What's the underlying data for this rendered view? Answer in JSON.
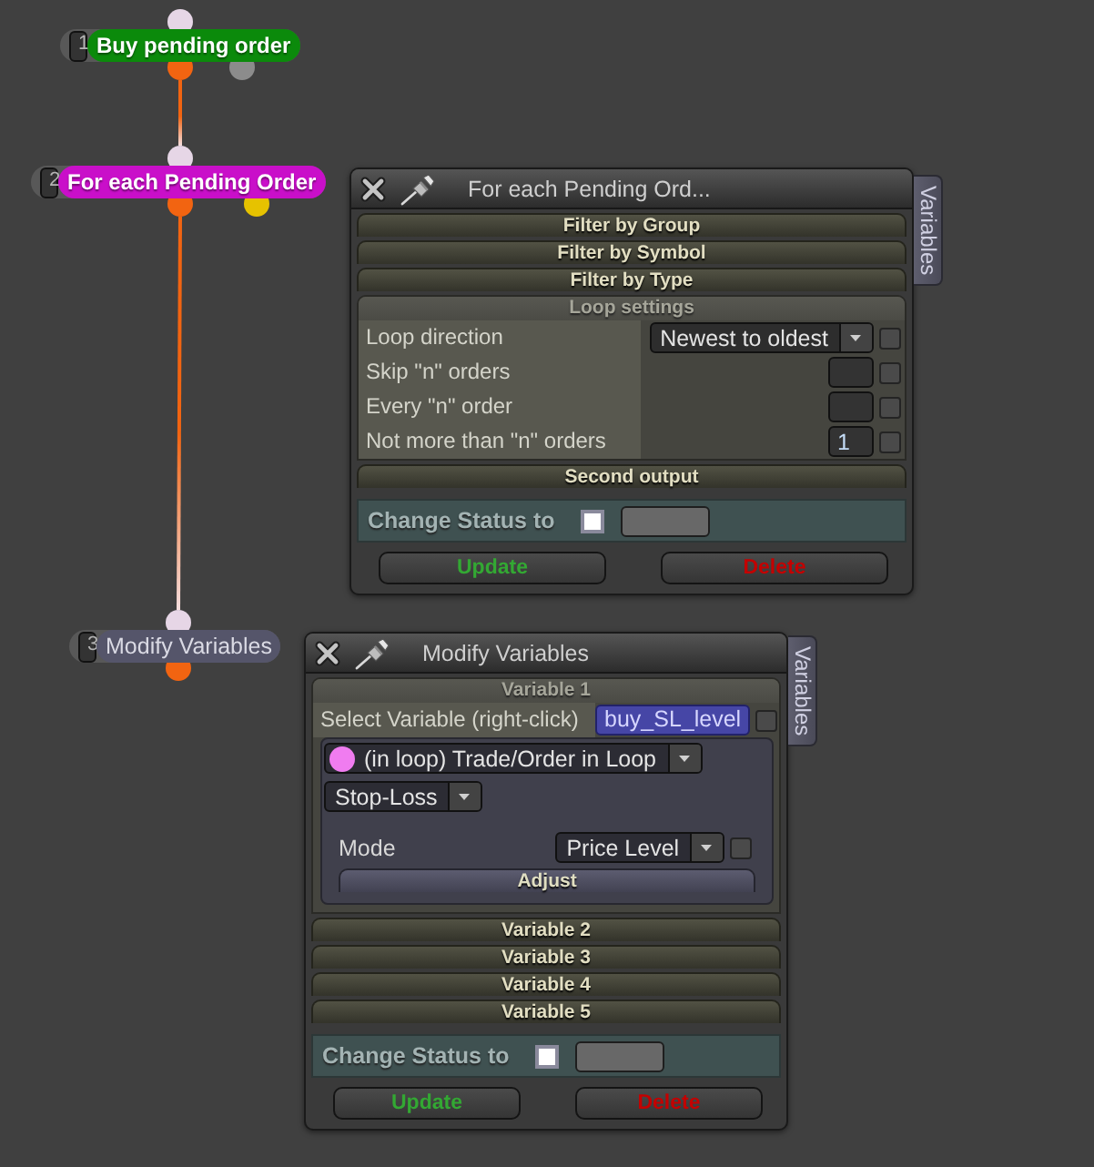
{
  "nodes": [
    {
      "number": "1",
      "label": "Buy pending order",
      "kind": "accent",
      "color": "#0b8a0b",
      "outputs": [
        {
          "color": "#f26411",
          "connected": true
        },
        {
          "color": "#8c8c8c",
          "connected": false
        }
      ]
    },
    {
      "number": "2",
      "label": "For each Pending Order",
      "kind": "accent",
      "color": "#c90fc9",
      "outputs": [
        {
          "color": "#f26411",
          "connected": true
        },
        {
          "color": "#e6c200",
          "connected": false
        }
      ]
    },
    {
      "number": "3",
      "label": "Modify Variables",
      "kind": "plain",
      "color": "#55556a",
      "outputs": [
        {
          "color": "#f26411",
          "connected": false
        }
      ]
    }
  ],
  "panels": [
    {
      "title": "For each Pending Ord...",
      "side_tab": "Variables",
      "sections": [
        {
          "label": "Filter by Group",
          "expanded": false
        },
        {
          "label": "Filter by Symbol",
          "expanded": false
        },
        {
          "label": "Filter by Type",
          "expanded": false
        },
        {
          "label": "Loop settings",
          "expanded": true,
          "rows": [
            {
              "kind": "dropdown",
              "label": "Loop direction",
              "value": "Newest to oldest",
              "checked": false
            },
            {
              "kind": "number",
              "label": "Skip \"n\" orders",
              "checked": false
            },
            {
              "kind": "number",
              "label": "Every \"n\" order",
              "checked": false
            },
            {
              "kind": "number",
              "label": "Not more than \"n\" orders",
              "value": "1",
              "checked": false
            }
          ]
        },
        {
          "label": "Second output",
          "expanded": false
        }
      ],
      "status": {
        "label": "Change Status to",
        "checked": false
      },
      "buttons": [
        {
          "label": "Update",
          "kind": "update"
        },
        {
          "label": "Delete",
          "kind": "delete"
        }
      ]
    },
    {
      "title": "Modify Variables",
      "side_tab": "Variables",
      "sections": [
        {
          "label": "Variable 1",
          "expanded": true,
          "rows": [
            {
              "kind": "variable",
              "label": "Select Variable (right-click)",
              "value": "buy_SL_level",
              "checked": false
            },
            {
              "kind": "group",
              "rows": [
                {
                  "kind": "select",
                  "value": "(in loop) Trade/Order in Loop",
                  "color": "#f07cf0"
                },
                {
                  "kind": "select",
                  "value": "Stop-Loss"
                },
                {
                  "kind": "dropdown",
                  "label": "Mode",
                  "value": "Price Level",
                  "checked": false
                },
                {
                  "kind": "section",
                  "label": "Adjust",
                  "expanded": false
                }
              ]
            }
          ]
        },
        {
          "label": "Variable 2",
          "expanded": false
        },
        {
          "label": "Variable 3",
          "expanded": false
        },
        {
          "label": "Variable 4",
          "expanded": false
        },
        {
          "label": "Variable 5",
          "expanded": false
        }
      ],
      "status": {
        "label": "Change Status to",
        "checked": false
      },
      "buttons": [
        {
          "label": "Update",
          "kind": "update"
        },
        {
          "label": "Delete",
          "kind": "delete"
        }
      ]
    }
  ]
}
